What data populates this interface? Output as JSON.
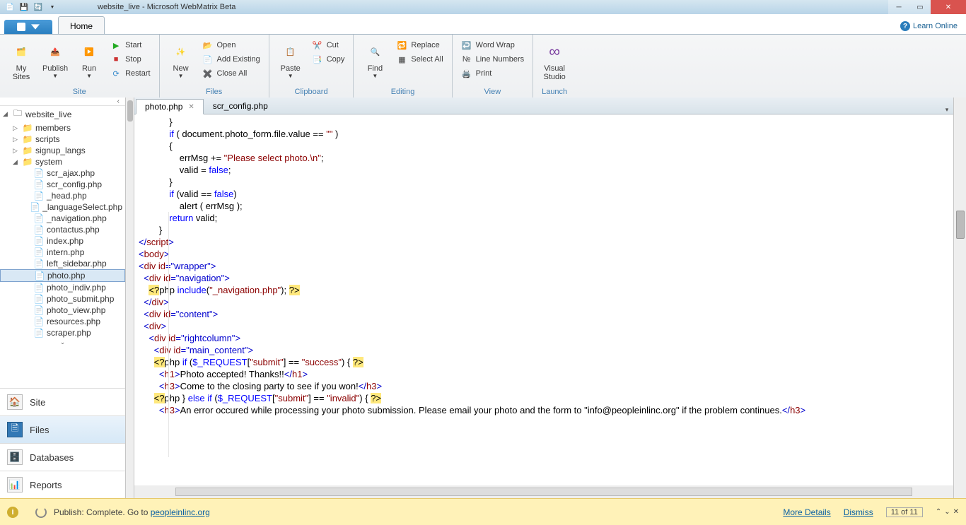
{
  "window": {
    "title": "website_live - Microsoft WebMatrix Beta"
  },
  "ribbon": {
    "fileMenu": "",
    "tabs": {
      "home": "Home"
    },
    "learn": "Learn Online",
    "groups": {
      "site": {
        "label": "Site",
        "mySites": "My\nSites",
        "publish": "Publish",
        "run": "Run",
        "start": "Start",
        "stop": "Stop",
        "restart": "Restart"
      },
      "files": {
        "label": "Files",
        "new": "New",
        "open": "Open",
        "addExisting": "Add Existing",
        "closeAll": "Close All"
      },
      "clipboard": {
        "label": "Clipboard",
        "paste": "Paste",
        "cut": "Cut",
        "copy": "Copy"
      },
      "editing": {
        "label": "Editing",
        "find": "Find",
        "replace": "Replace",
        "selectAll": "Select All"
      },
      "view": {
        "label": "View",
        "wordWrap": "Word Wrap",
        "lineNumbers": "Line Numbers",
        "print": "Print"
      },
      "launch": {
        "label": "Launch",
        "visualStudio": "Visual\nStudio"
      }
    }
  },
  "tree": {
    "root": "website_live",
    "folders": [
      "members",
      "scripts",
      "signup_langs",
      "system"
    ],
    "systemFiles": [
      "scr_ajax.php",
      "scr_config.php",
      "_head.php",
      "_languageSelect.php",
      "_navigation.php",
      "contactus.php",
      "index.php",
      "intern.php",
      "left_sidebar.php",
      "photo.php",
      "photo_indiv.php",
      "photo_submit.php",
      "photo_view.php",
      "resources.php",
      "scraper.php"
    ],
    "selected": "photo.php"
  },
  "navbar": {
    "site": "Site",
    "files": "Files",
    "databases": "Databases",
    "reports": "Reports",
    "active": "Files"
  },
  "tabs": {
    "items": [
      "photo.php",
      "scr_config.php"
    ],
    "active": "photo.php"
  },
  "code": {
    "l1": "            }",
    "l2a": "            ",
    "l2b": "if",
    "l2c": " ( document.photo_form.file.value == ",
    "l2d": "\"\"",
    "l2e": " )",
    "l3": "            {",
    "l4a": "                errMsg += ",
    "l4b": "\"Please select photo.\\n\"",
    "l4c": ";",
    "l5a": "                valid = ",
    "l5b": "false",
    "l5c": ";",
    "l6": "            }",
    "l7": "",
    "l8a": "            ",
    "l8b": "if",
    "l8c": " (valid == ",
    "l8d": "false",
    "l8e": ")",
    "l9": "                alert ( errMsg );",
    "l10": "",
    "l11a": "            ",
    "l11b": "return",
    "l11c": " valid;",
    "l12": "        }",
    "l13a": "</",
    "l13b": "script",
    "l13c": ">",
    "l14": "",
    "l15a": "<",
    "l15b": "body",
    "l15c": ">",
    "l16": "",
    "l17a": "<",
    "l17b": "div ",
    "l17c": "id",
    "l17d": "=",
    "l17e": "\"wrapper\"",
    "l17f": ">",
    "l18a": "  <",
    "l18b": "div ",
    "l18c": "id",
    "l18d": "=",
    "l18e": "\"navigation\"",
    "l18f": ">",
    "l19a": "    ",
    "l19b": "<?",
    "l19c": "php ",
    "l19d": "include",
    "l19e": "(",
    "l19f": "\"_navigation.php\"",
    "l19g": "); ",
    "l19h": "?>",
    "l20a": "  </",
    "l20b": "div",
    "l20c": ">",
    "l21a": "  <",
    "l21b": "div ",
    "l21c": "id",
    "l21d": "=",
    "l21e": "\"content\"",
    "l21f": ">",
    "l22a": "  <",
    "l22b": "div",
    "l22c": ">",
    "l23a": "    <",
    "l23b": "div ",
    "l23c": "id",
    "l23d": "=",
    "l23e": "\"rightcolumn\"",
    "l23f": ">",
    "l24a": "      <",
    "l24b": "div ",
    "l24c": "id",
    "l24d": "=",
    "l24e": "\"main_content\"",
    "l24f": ">",
    "l25": "",
    "l26a": "      ",
    "l26b": "<?",
    "l26c": "php ",
    "l26d": "if",
    "l26e": " (",
    "l26f": "$_REQUEST",
    "l26g": "[",
    "l26h": "\"submit\"",
    "l26i": "] == ",
    "l26j": "\"success\"",
    "l26k": ") { ",
    "l26l": "?>",
    "l27a": "        <",
    "l27b": "h1",
    "l27c": ">",
    "l27d": "Photo accepted! Thanks!!",
    "l27e": "</",
    "l27f": "h1",
    "l27g": ">",
    "l28a": "        <",
    "l28b": "h3",
    "l28c": ">",
    "l28d": "Come to the closing party to see if you won!",
    "l28e": "</",
    "l28f": "h3",
    "l28g": ">",
    "l29": "",
    "l30a": "      ",
    "l30b": "<?",
    "l30c": "php } ",
    "l30d": "else if",
    "l30e": " (",
    "l30f": "$_REQUEST",
    "l30g": "[",
    "l30h": "\"submit\"",
    "l30i": "] == ",
    "l30j": "\"invalid\"",
    "l30k": ") { ",
    "l30l": "?>",
    "l31a": "        <",
    "l31b": "h3",
    "l31c": ">",
    "l31d": "An error occured while processing your photo submission. Please email your photo and the form to \"info@peopleinlinc.org\" if the problem continues.",
    "l31e": "</",
    "l31f": "h3",
    "l31g": ">"
  },
  "status": {
    "text": "Publish: Complete. Go to ",
    "link": "peopleinlinc.org",
    "more": "More Details",
    "dismiss": "Dismiss",
    "counter": "11 of 11"
  }
}
